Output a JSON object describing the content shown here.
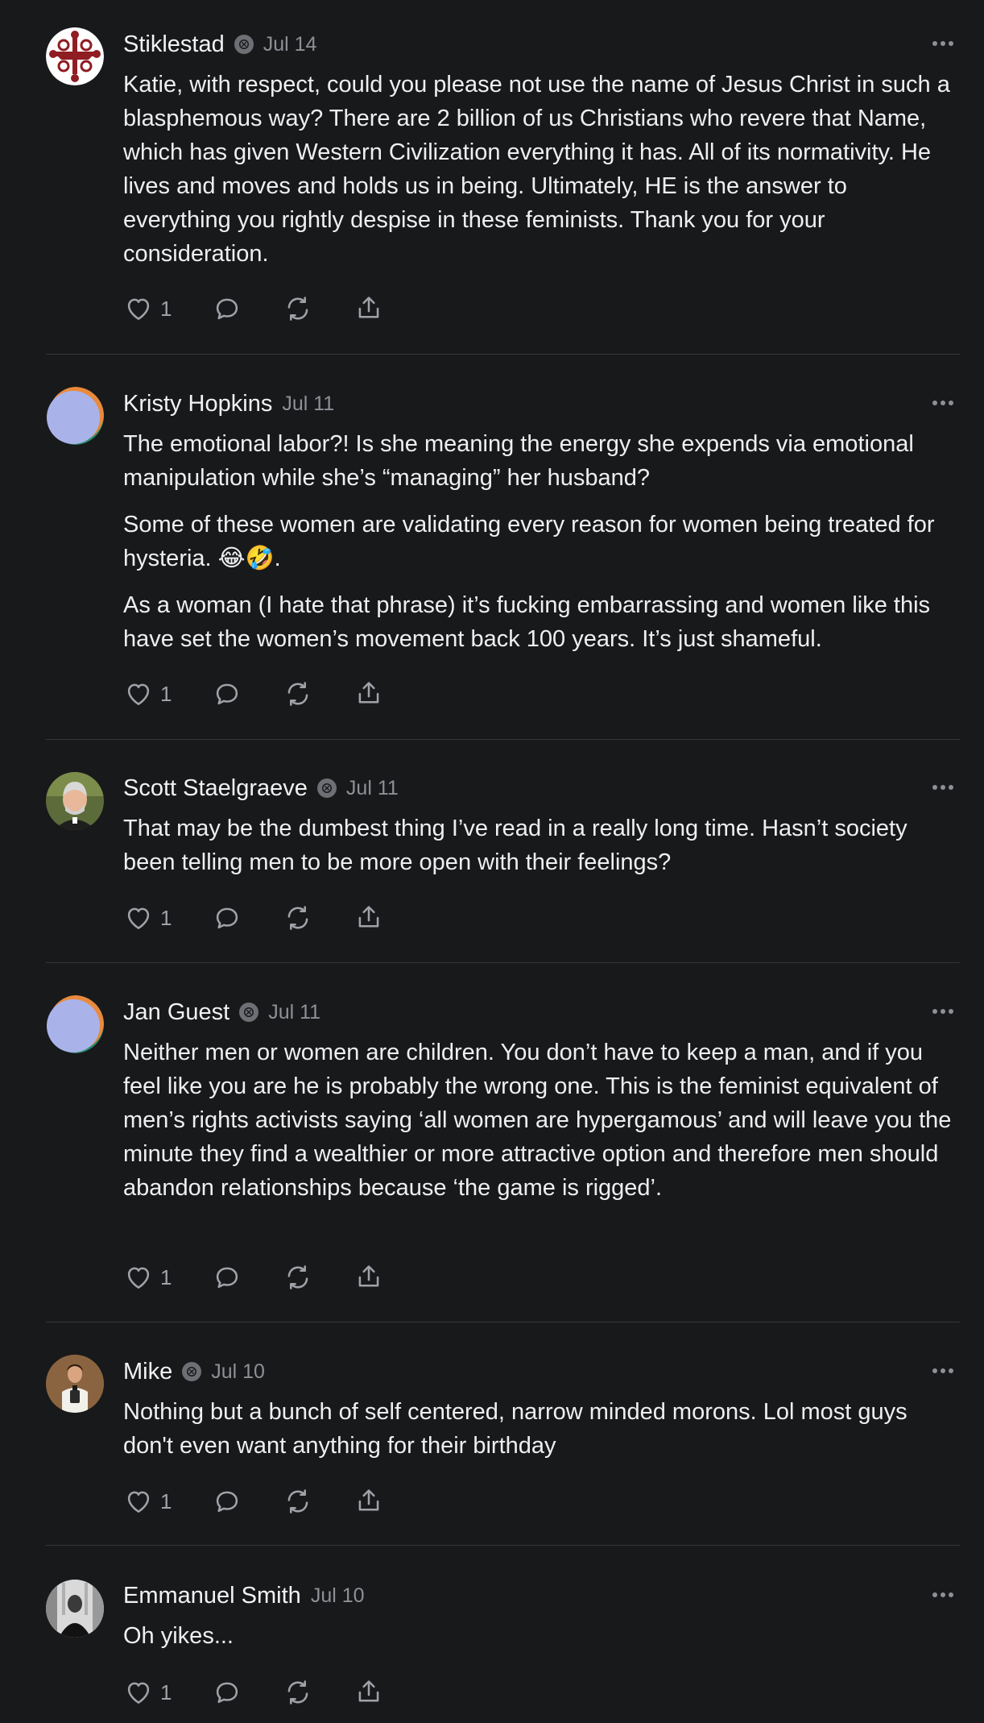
{
  "comments": [
    {
      "name": "Stiklestad",
      "verified": true,
      "date": "Jul 14",
      "avatar_icon": "cross-emblem-icon",
      "paragraphs": [
        "Katie, with respect, could you please not use the name of Jesus Christ in such a blasphemous way? There are 2 billion of us Christians who revere that Name, which has given Western Civilization everything it has. All of its normativity. He lives and moves and holds us in being. Ultimately, HE is the answer to everything you rightly despise in these feminists. Thank you for your consideration."
      ],
      "likes": "1"
    },
    {
      "name": "Kristy Hopkins",
      "verified": false,
      "date": "Jul 11",
      "avatar_icon": "default-avatar-icon",
      "paragraphs": [
        "The emotional labor?! Is she meaning the energy she expends via emotional manipulation while she’s “managing” her husband?",
        "Some of these women are validating every reason for women being treated for hysteria. 😂🤣.",
        "As a woman (I hate that phrase) it’s fucking embarrassing and women like this have set the women’s movement back 100 years. It’s just shameful."
      ],
      "likes": "1"
    },
    {
      "name": "Scott Staelgraeve",
      "verified": true,
      "date": "Jul 11",
      "avatar_icon": "user-photo-icon",
      "paragraphs": [
        "That may be the dumbest thing I’ve read in a really long time. Hasn’t society been telling men to be more open with their feelings?"
      ],
      "likes": "1"
    },
    {
      "name": "Jan Guest",
      "verified": true,
      "date": "Jul 11",
      "avatar_icon": "default-avatar-icon",
      "paragraphs": [
        "Neither men or women are children. You don’t have to keep a man, and if you feel like you are he is probably the wrong one. This is the feminist equivalent of men’s rights activists saying ‘all women are hypergamous’ and will leave you the minute they find a wealthier or more attractive option and therefore men should abandon relationships because ‘the game is rigged’."
      ],
      "likes": "1"
    },
    {
      "name": "Mike",
      "verified": true,
      "date": "Jul 10",
      "avatar_icon": "user-photo-icon",
      "paragraphs": [
        "Nothing but a bunch of self centered, narrow minded morons. Lol most guys don't even want anything for their birthday"
      ],
      "likes": "1"
    },
    {
      "name": "Emmanuel Smith",
      "verified": false,
      "date": "Jul 10",
      "avatar_icon": "user-photo-icon",
      "paragraphs": [
        "Oh yikes..."
      ],
      "likes": "1"
    }
  ]
}
